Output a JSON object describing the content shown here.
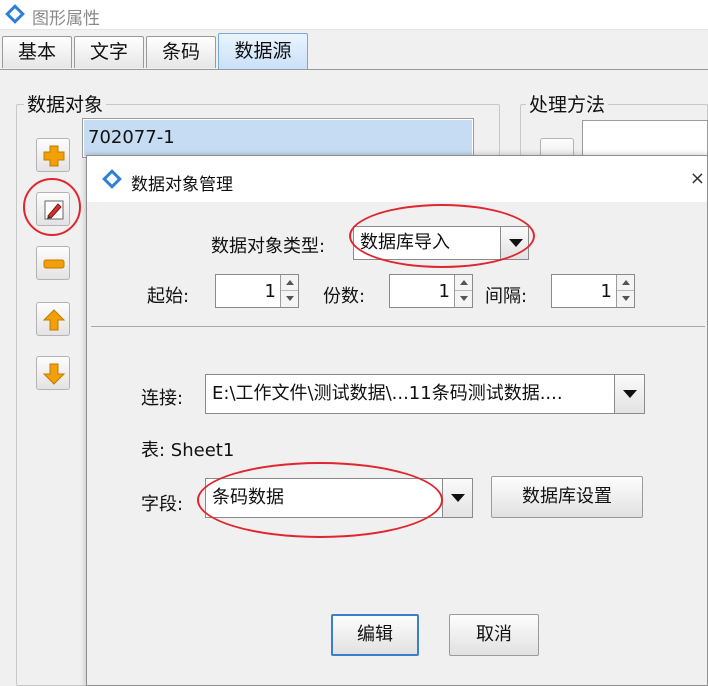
{
  "window": {
    "title": "图形属性"
  },
  "tabs": [
    {
      "label": "基本",
      "active": false
    },
    {
      "label": "文字",
      "active": false
    },
    {
      "label": "条码",
      "active": false
    },
    {
      "label": "数据源",
      "active": true
    }
  ],
  "data_objects": {
    "group_label": "数据对象",
    "items": [
      "702077-1"
    ]
  },
  "processing": {
    "group_label": "处理方法"
  },
  "dialog": {
    "title": "数据对象管理",
    "type_label": "数据对象类型:",
    "type_value": "数据库导入",
    "start_label": "起始:",
    "start_value": "1",
    "copies_label": "份数:",
    "copies_value": "1",
    "interval_label": "间隔:",
    "interval_value": "1",
    "connection_label": "连接:",
    "connection_value": "E:\\工作文件\\测试数据\\...11条码测试数据....",
    "table_label": "表: Sheet1",
    "field_label": "字段:",
    "field_value": "条码数据",
    "db_settings_button": "数据库设置",
    "edit_button": "编辑",
    "cancel_button": "取消",
    "close_glyph": "×"
  },
  "colors": {
    "highlight_red": "#e0262f",
    "selection_blue": "#c6dcf2",
    "add_icon_orange": "#f2a007"
  },
  "icons": {
    "app": "app-icon",
    "add": "plus-icon",
    "edit": "pencil-icon",
    "remove": "minus-icon",
    "move_up": "arrow-up-icon",
    "move_down": "arrow-down-icon"
  }
}
